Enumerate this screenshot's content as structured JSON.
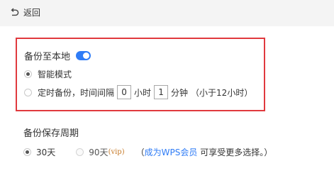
{
  "topbar": {
    "back_label": "返回"
  },
  "backup": {
    "title": "备份至本地",
    "toggle_on": true,
    "accent_color": "#2f7cf6",
    "options": [
      {
        "label": "智能模式",
        "selected": true
      },
      {
        "label": "定时备份，时间间隔",
        "selected": false,
        "hours_value": "0",
        "hours_unit": "小时",
        "minutes_value": "1",
        "minutes_unit": "分钟",
        "note": "（小于12小时）"
      }
    ]
  },
  "retention": {
    "title": "备份保存周期",
    "options": [
      {
        "label": "30天",
        "selected": true
      },
      {
        "label": "90天",
        "suffix": "(vip)",
        "selected": false,
        "disabled": true
      }
    ],
    "hint_open": "（",
    "hint_link": "成为WPS会员",
    "hint_text": " 可享受更多选择。）"
  },
  "highlight_color": "#e0393e"
}
